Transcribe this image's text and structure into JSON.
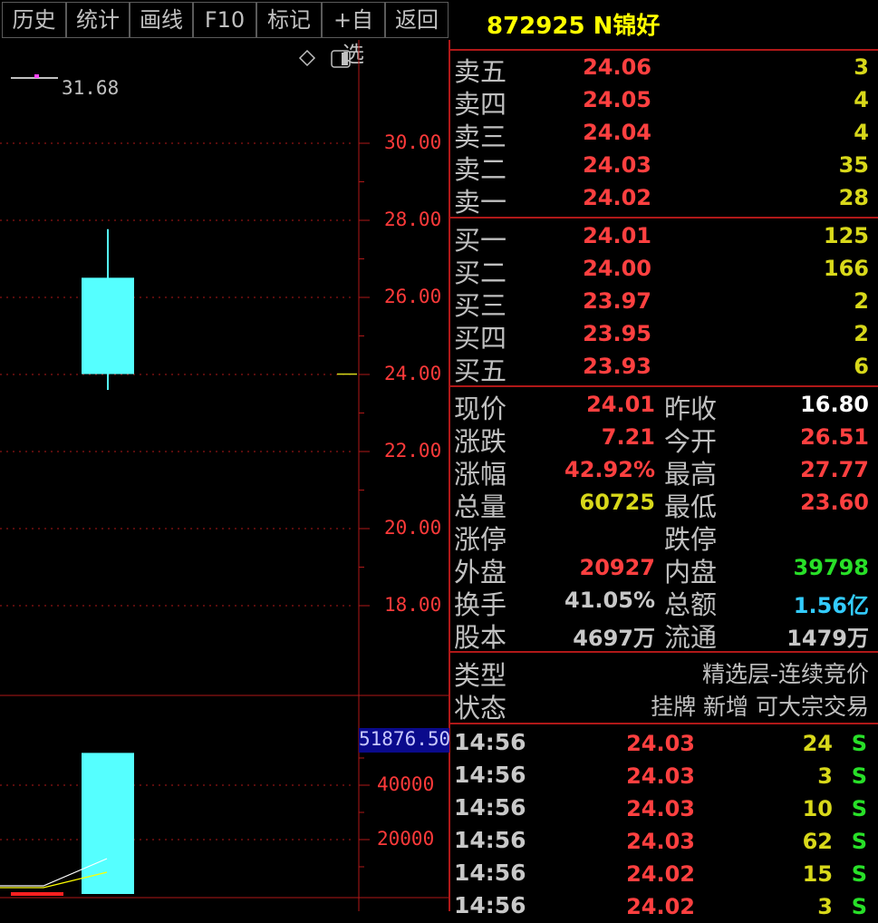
{
  "toolbar": {
    "buttons": [
      "历史",
      "统计",
      "画线",
      "F10",
      "标记",
      "+自选",
      "返回"
    ]
  },
  "chart": {
    "ma_label": "31.68",
    "price_ticks": [
      "30.00",
      "28.00",
      "26.00",
      "24.00",
      "22.00",
      "20.00",
      "18.00"
    ],
    "volume_highlight": "51876.50",
    "volume_ticks": [
      "40000",
      "20000"
    ],
    "colors": {
      "up_candle": "#55ffff",
      "grid": "#b01818",
      "axis_text": "#ff3a3a"
    }
  },
  "chart_data": {
    "type": "candlestick",
    "candles": [
      {
        "open": 24.01,
        "close": 26.51,
        "high": 27.77,
        "low": 23.6,
        "volume": 51876.5
      }
    ],
    "price_ylim": [
      17.0,
      32.0
    ],
    "volume_ylim": [
      0,
      55000
    ],
    "price_ticks": [
      30,
      28,
      26,
      24,
      22,
      20,
      18
    ],
    "volume_ticks": [
      40000,
      20000
    ],
    "ma_value": 31.68
  },
  "quote": {
    "code_name": "872925 N锦好",
    "asks": [
      {
        "label": "卖五",
        "price": "24.06",
        "vol": "3"
      },
      {
        "label": "卖四",
        "price": "24.05",
        "vol": "4"
      },
      {
        "label": "卖三",
        "price": "24.04",
        "vol": "4"
      },
      {
        "label": "卖二",
        "price": "24.03",
        "vol": "35"
      },
      {
        "label": "卖一",
        "price": "24.02",
        "vol": "28"
      }
    ],
    "bids": [
      {
        "label": "买一",
        "price": "24.01",
        "vol": "125"
      },
      {
        "label": "买二",
        "price": "24.00",
        "vol": "166"
      },
      {
        "label": "买三",
        "price": "23.97",
        "vol": "2"
      },
      {
        "label": "买四",
        "price": "23.95",
        "vol": "2"
      },
      {
        "label": "买五",
        "price": "23.93",
        "vol": "6"
      }
    ],
    "stats": [
      {
        "l1": "现价",
        "v1": "24.01",
        "c1": "#ff4040",
        "l2": "昨收",
        "v2": "16.80",
        "c2": "#ffffff"
      },
      {
        "l1": "涨跌",
        "v1": "7.21",
        "c1": "#ff4040",
        "l2": "今开",
        "v2": "26.51",
        "c2": "#ff4040"
      },
      {
        "l1": "涨幅",
        "v1": "42.92%",
        "c1": "#ff4040",
        "l2": "最高",
        "v2": "27.77",
        "c2": "#ff4040"
      },
      {
        "l1": "总量",
        "v1": "60725",
        "c1": "#d8d81a",
        "l2": "最低",
        "v2": "23.60",
        "c2": "#ff4040"
      },
      {
        "l1": "涨停",
        "v1": "",
        "c1": "#ff4040",
        "l2": "跌停",
        "v2": "",
        "c2": "#ff4040"
      },
      {
        "l1": "外盘",
        "v1": "20927",
        "c1": "#ff4040",
        "l2": "内盘",
        "v2": "39798",
        "c2": "#28e028"
      },
      {
        "l1": "换手",
        "v1": "41.05%",
        "c1": "#c8c8c8",
        "l2": "总额",
        "v2": "1.56亿",
        "c2": "#33ccff"
      },
      {
        "l1": "股本",
        "v1": "4697万",
        "c1": "#c8c8c8",
        "l2": "流通",
        "v2": "1479万",
        "c2": "#c8c8c8"
      }
    ],
    "info": [
      {
        "label": "类型",
        "value": "精选层-连续竞价"
      },
      {
        "label": "状态",
        "value": "挂牌 新增 可大宗交易"
      }
    ],
    "ticks": [
      {
        "time": "14:56",
        "price": "24.03",
        "vol": "24",
        "side": "S"
      },
      {
        "time": "14:56",
        "price": "24.03",
        "vol": "3",
        "side": "S"
      },
      {
        "time": "14:56",
        "price": "24.03",
        "vol": "10",
        "side": "S"
      },
      {
        "time": "14:56",
        "price": "24.03",
        "vol": "62",
        "side": "S"
      },
      {
        "time": "14:56",
        "price": "24.02",
        "vol": "15",
        "side": "S"
      },
      {
        "time": "14:56",
        "price": "24.02",
        "vol": "3",
        "side": "S"
      }
    ]
  }
}
